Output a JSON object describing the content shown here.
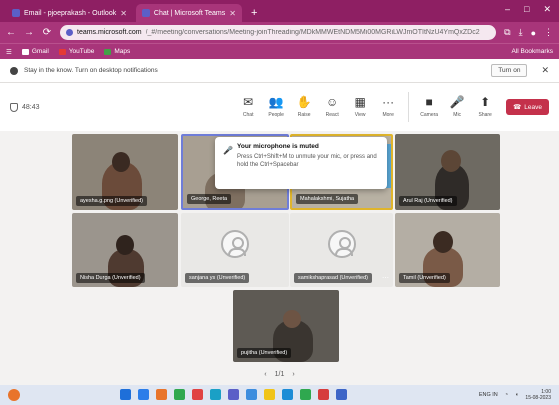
{
  "browser": {
    "tabs": [
      {
        "label": "Email - pjoeprakash - Outlook",
        "active": false
      },
      {
        "label": "Chat | Microsoft Teams",
        "active": true
      }
    ],
    "new_tab": "+",
    "window_controls": [
      "–",
      "□",
      "✕"
    ],
    "url_host": "teams.microsoft.com",
    "url_path": "/_#/meeting/conversations/Meeting-joinThreading/MDkMMWEtNDM5Mi00MGRiLWJmOTItNzU4YmQxZDc2",
    "bookmarks": [
      {
        "label": "Gmail",
        "color": "#ffffff"
      },
      {
        "label": "YouTube",
        "color": "#e53935"
      },
      {
        "label": "Maps",
        "color": "#43a047"
      }
    ],
    "all_bookmarks": "All Bookmarks"
  },
  "notification": {
    "text": "Stay in the know. Turn on desktop notifications",
    "turn_on": "Turn on"
  },
  "meeting": {
    "timer": "48:43",
    "toolbar": [
      {
        "icon": "chat-icon",
        "glyph": "✉",
        "label": "Chat"
      },
      {
        "icon": "people-icon",
        "glyph": "👥",
        "label": "People"
      },
      {
        "icon": "raise-hand-icon",
        "glyph": "✋",
        "label": "Raise"
      },
      {
        "icon": "react-icon",
        "glyph": "☺",
        "label": "React"
      },
      {
        "icon": "view-icon",
        "glyph": "▦",
        "label": "View"
      },
      {
        "icon": "more-icon",
        "glyph": "···",
        "label": "More"
      },
      {
        "icon": "camera-icon",
        "glyph": "■",
        "label": "Camera"
      },
      {
        "icon": "mic-icon",
        "glyph": "🎤",
        "label": "Mic"
      },
      {
        "icon": "share-icon",
        "glyph": "⬆",
        "label": "Share"
      }
    ],
    "leave_label": "Leave",
    "toast": {
      "title": "Your microphone is muted",
      "body": "Press Ctrl+Shift+M to unmute your mic, or press and hold the Ctrl+Spacebar"
    },
    "participants": [
      {
        "name": "ayesha.g.png (Unverified)",
        "video": true
      },
      {
        "name": "George, Reeta",
        "video": true
      },
      {
        "name": "Mahalakshmi, Sujatha",
        "video": true
      },
      {
        "name": "Arul Raj (Unverified)",
        "video": true
      },
      {
        "name": "Nisha Durga (Unverified)",
        "video": true
      },
      {
        "name": "sanjana ys (Unverified)",
        "video": false
      },
      {
        "name": "samikshaprasad (Unverified)",
        "video": false
      },
      {
        "name": "Tamil (Unverified)",
        "video": true
      },
      {
        "name": "pujitha (Unverified)",
        "video": true
      }
    ],
    "pager": {
      "prev": "‹",
      "page": "1/1",
      "next": "›"
    }
  },
  "taskbar": {
    "apps": [
      "#1e6fd9",
      "#2b7de9",
      "#e8742b",
      "#2fa84f",
      "#e04343",
      "#1aa0c6",
      "#5b5fc7",
      "#3c8dde",
      "#f0c419",
      "#1c8cd6",
      "#2fa84f",
      "#d63c3c",
      "#3d65c7"
    ],
    "tray_text": "ENG IN",
    "time": "1:00",
    "date": "15-08-2023"
  }
}
